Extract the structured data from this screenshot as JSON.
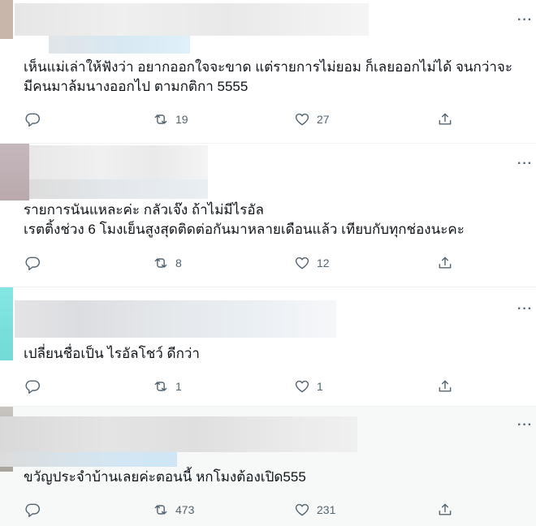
{
  "replies": [
    {
      "lines": [
        "เห็นแม่เล่าให้ฟังว่า อยากออกใจจะขาด แต่รายการไม่ยอม ก็เลยออกไม่ได้ จนกว่าจะ",
        "มีคนมาล้มนางออกไป ตามกติกา 5555"
      ],
      "retweets": "19",
      "likes": "27",
      "avatar_color": "#c9b6aa"
    },
    {
      "lines": [
        "รายการนันแหละค่ะ  กลัวเจ๊ง ถ้าไม่มีไรอัล",
        "เรตติ้งช่วง 6 โมงเย็นสูงสุดติดต่อกันมาหลายเดือนแล้ว เทียบกับทุกช่องนะคะ"
      ],
      "retweets": "8",
      "likes": "12",
      "avatar_color": "#b9a9ad"
    },
    {
      "lines": [
        "เปลี่ยนชื่อเป็น ไรอัลโชว์ ดีกว่า"
      ],
      "retweets": "1",
      "likes": "1",
      "avatar_color": "#7ee0dc"
    },
    {
      "lines": [
        "ขวัญประจำบ้านเลยค่ะตอนนี้ หกโมงต้องเปิด555"
      ],
      "retweets": "473",
      "likes": "231",
      "avatar_color": "#b8b2ac"
    }
  ],
  "more_label": "···"
}
